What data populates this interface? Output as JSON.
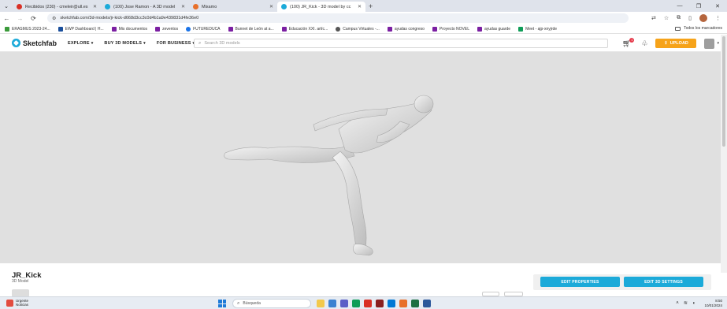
{
  "browser": {
    "tabs": [
      {
        "title": "Recibidos (230) - cmeleir@ull.es",
        "icon_color": "#d93025",
        "active": false
      },
      {
        "title": "(100) Jose Ramon - A 3D model",
        "icon_color": "#1caad9",
        "active": false
      },
      {
        "title": "Mixamo",
        "icon_color": "#e8702a",
        "active": false
      },
      {
        "title": "(100) JR_Kick - 3D model by cc",
        "icon_color": "#1caad9",
        "active": true
      }
    ],
    "new_tab_symbol": "+",
    "url": "sketchfab.com/3d-models/jr-kick-d668d3cc3c0d4b1a9e439831d4fe36e0",
    "bookmarks": [
      {
        "label": "ERASMUS 2023-24...",
        "color": "#3a9a3a"
      },
      {
        "label": "EWP Dashboard | H...",
        "color": "#1a4f9c"
      },
      {
        "label": "Mis documentos",
        "color": "#7b1fa2"
      },
      {
        "label": "zeventos",
        "color": "#7b1fa2"
      },
      {
        "label": "FUTUREDUCA",
        "color": "#1a73e8"
      },
      {
        "label": "Bunnet de León at a...",
        "color": "#7b1fa2"
      },
      {
        "label": "Educación XXI. artíc...",
        "color": "#7b1fa2"
      },
      {
        "label": "Campus Virtuales -...",
        "color": "#555555"
      },
      {
        "label": "ayudas congreso",
        "color": "#7b1fa2"
      },
      {
        "label": "Proyecto NOVEL",
        "color": "#7b1fa2"
      },
      {
        "label": "ayudas guarde",
        "color": "#7b1fa2"
      },
      {
        "label": "Meet - ajp-xnyjrde",
        "color": "#0f9d58"
      }
    ],
    "all_bookmarks": "Todos los marcadores"
  },
  "site": {
    "logo": "Sketchfab",
    "nav": [
      {
        "label": "EXPLORE"
      },
      {
        "label": "BUY 3D MODELS"
      },
      {
        "label": "FOR BUSINESS"
      }
    ],
    "search_placeholder": "Search 3D models",
    "cart_badge": "1",
    "upload_label": "UPLOAD"
  },
  "model": {
    "title": "JR_Kick",
    "subtitle": "3D Model",
    "edit_properties": "EDIT PROPERTIES",
    "edit_3d_settings": "EDIT 3D SETTINGS",
    "viewer_bg": "#e0e0e0"
  },
  "taskbar": {
    "weather_title": "Urgente",
    "weather_sub": "Noticias",
    "search_label": "Búsqueda",
    "apps": [
      "#f2c94c",
      "#3b82d1",
      "#5b5fc7",
      "#0f9d58",
      "#d93025",
      "#8a1f1f",
      "#0078d4",
      "#e8702a",
      "#1d6f42",
      "#2b579a"
    ],
    "time": "8:50",
    "date": "10/01/2024"
  },
  "colors": {
    "accent": "#1caad9",
    "upload": "#f6a31a"
  }
}
